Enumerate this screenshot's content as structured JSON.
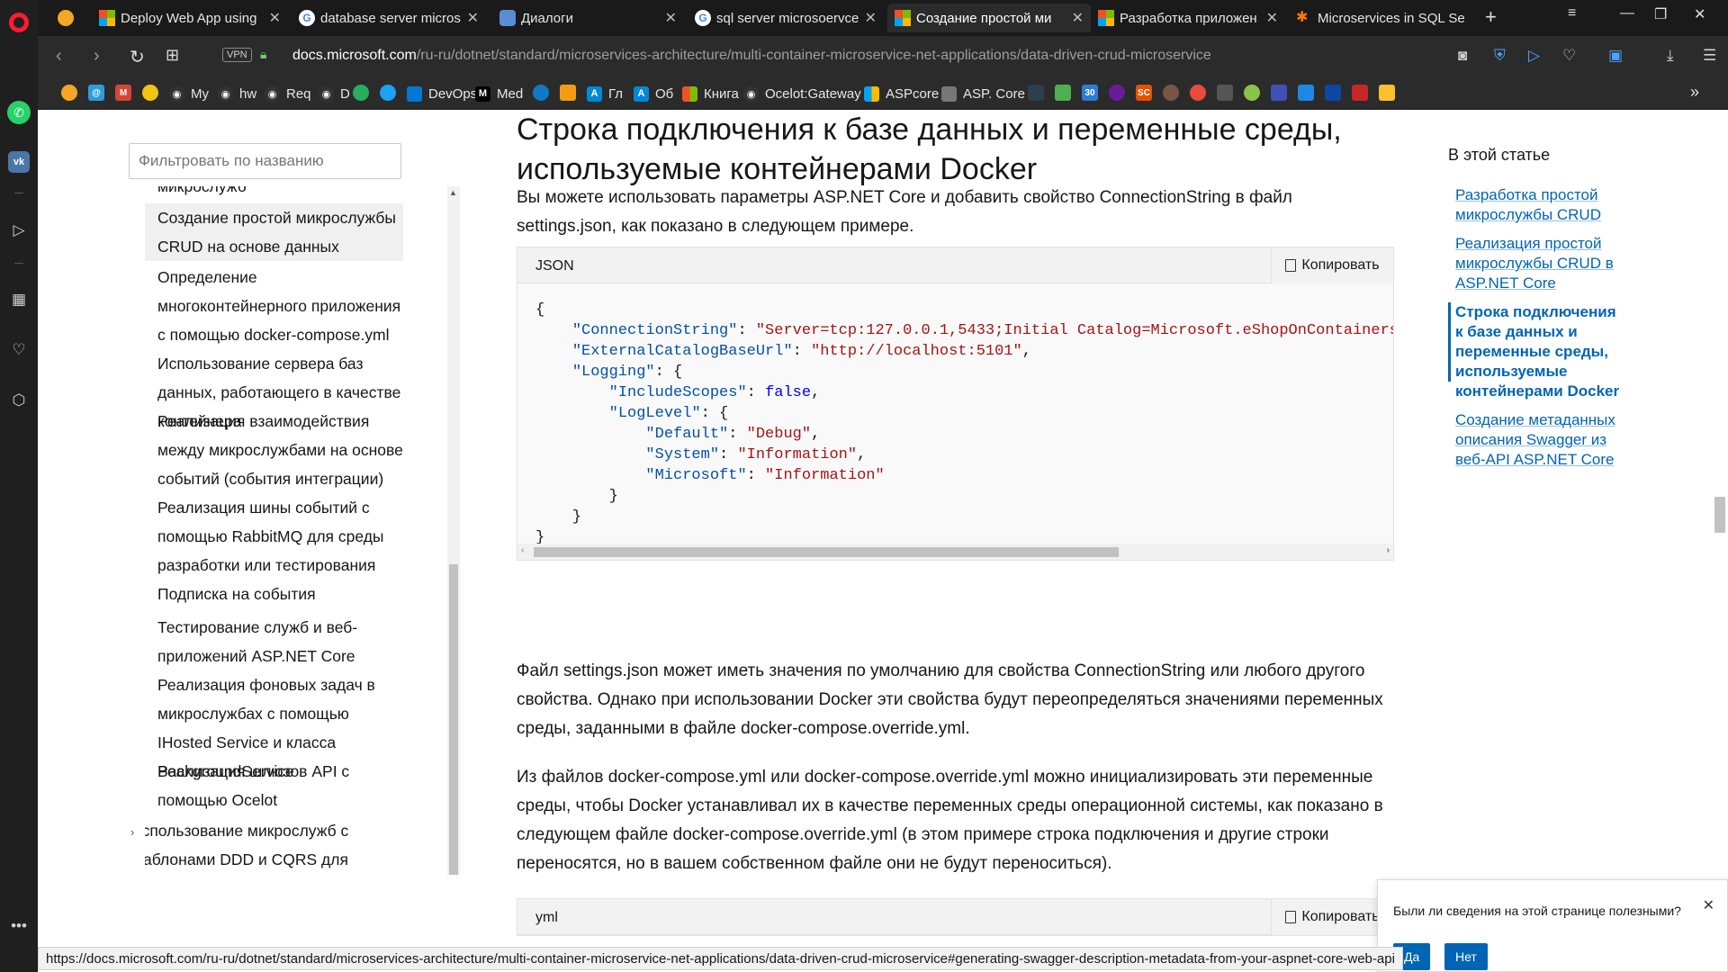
{
  "browser": {
    "tabs": [
      {
        "title": "",
        "favicon": "orange-circle",
        "active": false
      },
      {
        "title": "Deploy Web App using",
        "favicon": "microsoft",
        "active": false
      },
      {
        "title": "database server micros",
        "favicon": "google",
        "active": false
      },
      {
        "title": "Диалоги",
        "favicon": "dialogs",
        "active": false
      },
      {
        "title": "sql server microsoervce",
        "favicon": "google",
        "active": false
      },
      {
        "title": "Создание простой ми",
        "favicon": "microsoft",
        "active": true
      },
      {
        "title": "Разработка приложен",
        "favicon": "microsoft",
        "active": false
      },
      {
        "title": "Microservices in SQL Se",
        "favicon": "star",
        "active": false
      }
    ],
    "address": {
      "vpn": "VPN",
      "domain": "docs.microsoft.com",
      "path": "/ru-ru/dotnet/standard/microservices-architecture/multi-container-microservice-net-applications/data-driven-crud-microservice"
    },
    "bookmarks": [
      {
        "label": "My",
        "icon": "github-icon",
        "color": "#333333"
      },
      {
        "label": "hw",
        "icon": "github-icon",
        "color": "#333333"
      },
      {
        "label": "Req",
        "icon": "github-icon",
        "color": "#333333"
      },
      {
        "label": "D",
        "icon": "github-icon",
        "color": "#333333"
      },
      {
        "label": "DevOps",
        "icon": "devops-icon",
        "color": "#0078d4"
      },
      {
        "label": "Med",
        "icon": "medium-icon",
        "color": "#000000"
      },
      {
        "label": "Гл",
        "icon": "azure-icon",
        "color": "#0089d6"
      },
      {
        "label": "Об",
        "icon": "azure-icon",
        "color": "#0089d6"
      },
      {
        "label": "Книга",
        "icon": "microsoft-icon",
        "color": "#00a4ef"
      },
      {
        "label": "Ocelot:Gateway",
        "icon": "github-icon",
        "color": "#333333"
      },
      {
        "label": "ASPcore",
        "icon": "microsoft-icon",
        "color": "#00a4ef"
      },
      {
        "label": "ASP. Core",
        "icon": "mail-icon",
        "color": "#777777"
      }
    ]
  },
  "toc": {
    "filter_placeholder": "Фильтровать по названию",
    "items": [
      {
        "label": "микрослужб",
        "active": false
      },
      {
        "label": "Создание простой микрослужбы CRUD на основе данных",
        "active": true
      },
      {
        "label": "Определение многоконтейнерного приложения с помощью docker-compose.yml",
        "active": false
      },
      {
        "label": "Использование сервера баз данных, работающего в качестве контейнера",
        "active": false
      },
      {
        "label": "Реализация взаимодействия между микрослужбами на основе событий (события интеграции)",
        "active": false
      },
      {
        "label": "Реализация шины событий с помощью RabbitMQ для среды разработки или тестирования",
        "active": false
      },
      {
        "label": "Подписка на события",
        "active": false
      },
      {
        "label": "Тестирование служб и веб-приложений ASP.NET Core",
        "active": false
      },
      {
        "label": "Реализация фоновых задач в микрослужбах с помощью IHosted Service и класса BackgroundService",
        "active": false
      },
      {
        "label": "Реализация шлюзов API с помощью Ocelot",
        "active": false
      },
      {
        "label": "Использование микрослужб с шаблонами DDD и CQRS для решения сложных бизнес-задач",
        "active": false
      }
    ]
  },
  "article": {
    "heading": "Строка подключения к базе данных и переменные среды, используемые контейнерами Docker",
    "p1": "Вы можете использовать параметры ASP.NET Core и добавить свойство ConnectionString в файл settings.json, как показано в следующем примере.",
    "code1": {
      "lang": "JSON",
      "copy": "Копировать"
    },
    "p2": "Файл settings.json может иметь значения по умолчанию для свойства ConnectionString или любого другого свойства. Однако при использовании Docker эти свойства будут переопределяться значениями переменных среды, заданными в файле docker-compose.override.yml.",
    "p3": "Из файлов docker-compose.yml или docker-compose.override.yml можно инициализировать эти переменные среды, чтобы Docker устанавливал их в качестве переменных среды операционной системы, как показано в следующем файле docker-compose.override.yml (в этом примере строка подключения и другие строки переносятся, но в вашем собственном файле они не будут переноситься).",
    "code2": {
      "lang": "yml",
      "copy": "Копировать"
    }
  },
  "right_toc": {
    "title": "В этой статье",
    "items": [
      {
        "label": "Разработка простой микрослужбы CRUD",
        "active": false
      },
      {
        "label": "Реализация простой микрослужбы CRUD в ASP.NET Core",
        "active": false
      },
      {
        "label": "Строка подключения к базе данных и переменные среды, используемые контейнерами Docker",
        "active": true
      },
      {
        "label": "Создание метаданных описания Swagger из веб-API ASP.NET Core",
        "active": false
      }
    ]
  },
  "feedback": {
    "question": "Были ли сведения на этой странице полезными?",
    "yes": "Да",
    "no": "Нет"
  },
  "status_url": "https://docs.microsoft.com/ru-ru/dotnet/standard/microservices-architecture/multi-container-microservice-net-applications/data-driven-crud-microservice#generating-swagger-description-metadata-from-your-aspnet-core-web-api",
  "colors": {
    "accent": "#0065b3",
    "opera_red": "#ff1b2d",
    "json_key": "#0451a5",
    "json_string": "#a31515",
    "json_bool": "#0000ff"
  }
}
